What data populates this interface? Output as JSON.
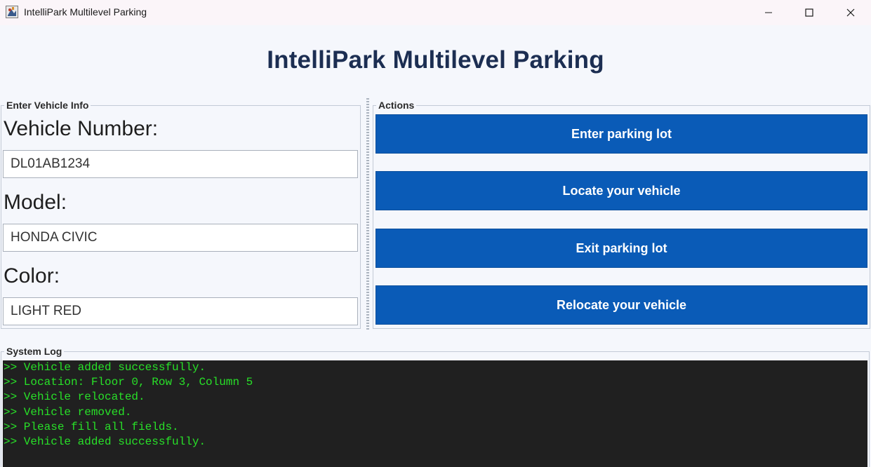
{
  "window": {
    "title": "IntelliPark Multilevel Parking",
    "app_icon": "java-app-icon",
    "controls": [
      "minimize-icon",
      "maximize-icon",
      "close-icon"
    ]
  },
  "header": {
    "title": "IntelliPark Multilevel Parking"
  },
  "vehicle_info": {
    "legend": "Enter Vehicle Info",
    "fields": [
      {
        "label": "Vehicle Number:",
        "value": "DL01AB1234"
      },
      {
        "label": "Model:",
        "value": "HONDA CIVIC"
      },
      {
        "label": "Color:",
        "value": "LIGHT RED"
      }
    ]
  },
  "actions": {
    "legend": "Actions",
    "buttons": [
      "Enter parking lot",
      "Locate your vehicle",
      "Exit parking lot",
      "Relocate your vehicle"
    ]
  },
  "system_log": {
    "legend": "System Log",
    "lines": [
      ">> Vehicle added successfully.",
      ">> Location: Floor 0, Row 3, Column 5",
      ">> Vehicle relocated.",
      ">> Vehicle removed.",
      ">> Please fill all fields.",
      ">> Vehicle added successfully."
    ]
  },
  "colors": {
    "accent_button": "#0a5bb7",
    "title_text": "#1c2e52",
    "log_background": "#202020",
    "log_text": "#28e028"
  }
}
